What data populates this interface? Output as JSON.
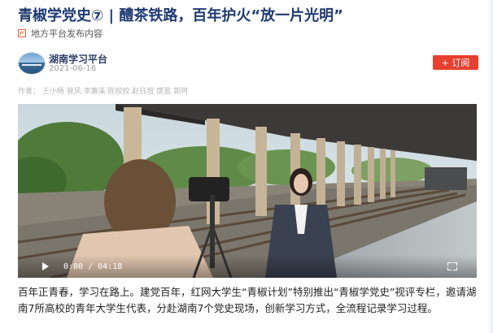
{
  "article": {
    "title": "青椒学党史⑦ | 醴茶铁路，百年护火“放一片光明”",
    "source_label": "地方平台发布内容",
    "author": {
      "name": "湖南学习平台",
      "date": "2021-06-16",
      "subscribe_label": "+ 订阅"
    },
    "credits": "作者：  王小杨  管风  李蕙溪  陈姣姣  赵珏煜  唐盈  郭珂",
    "video": {
      "time": "0:00 / 04:18"
    },
    "body": "百年正青春，学习在路上。建党百年，红网大学生“青椒计划”特别推出“青椒学党史”视评专栏，邀请湖南7所高校的青年大学生代表，分赴湖南7个党史现场，创新学习方式，全流程记录学习过程。"
  },
  "icons": {
    "source": "document-icon",
    "play": "play-icon",
    "fullscreen": "fullscreen-icon"
  },
  "colors": {
    "title": "#1f3a70",
    "subscribe": "#e8402f",
    "source_icon": "#e05a2a"
  }
}
